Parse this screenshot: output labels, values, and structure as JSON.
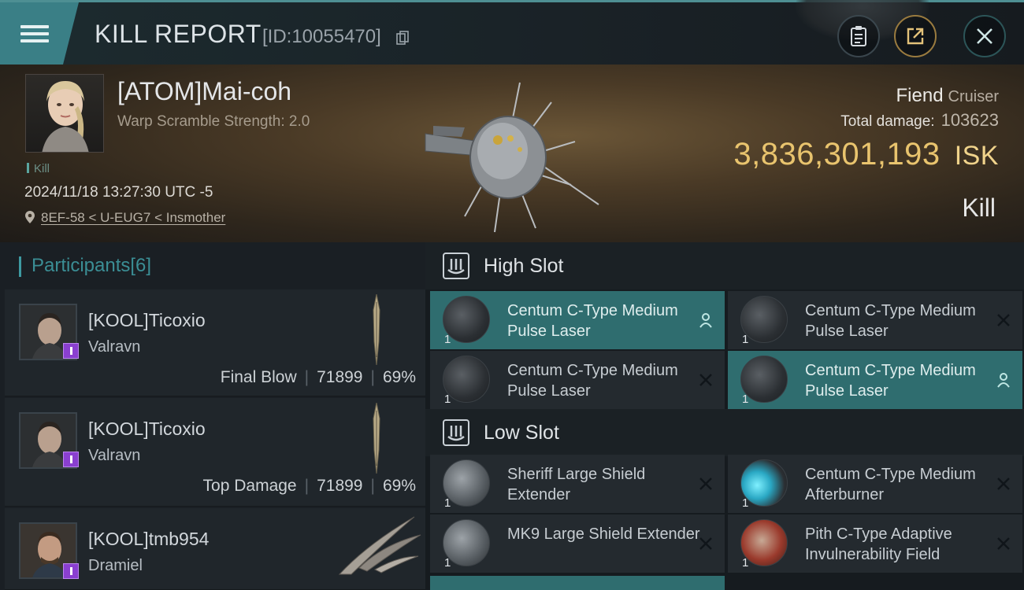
{
  "header": {
    "title": "KILL REPORT",
    "report_id": "[ID:10055470]",
    "icons": [
      "menu-icon",
      "copy-icon",
      "clipboard-icon",
      "share-icon",
      "close-icon"
    ]
  },
  "victim": {
    "name": "[ATOM]Mai-coh",
    "warp_scramble": "Warp Scramble Strength: 2.0",
    "tag": "Kill",
    "datetime": "2024/11/18 13:27:30 UTC -5",
    "location": "8EF-58 < U-EUG7 < Insmother",
    "ship_name": "Fiend",
    "ship_class": "Cruiser",
    "total_damage_label": "Total damage:",
    "total_damage": "103623",
    "isk_value": "3,836,301,193",
    "isk_unit": "ISK",
    "result": "Kill"
  },
  "participants": {
    "label": "Participants",
    "count": "[6]",
    "rows": [
      {
        "name": "[KOOL]Ticoxio",
        "ship": "Valravn",
        "role": "Final Blow",
        "damage": "71899",
        "percent": "69%"
      },
      {
        "name": "[KOOL]Ticoxio",
        "ship": "Valravn",
        "role": "Top Damage",
        "damage": "71899",
        "percent": "69%"
      },
      {
        "name": "[KOOL]tmb954",
        "ship": "Dramiel",
        "role": "",
        "damage": "",
        "percent": ""
      }
    ]
  },
  "slots": {
    "high": {
      "label": "High Slot",
      "modules": [
        {
          "name": "Centum C-Type Medium Pulse Laser",
          "qty": "1",
          "state": "dropped",
          "highlight": true
        },
        {
          "name": "Centum C-Type Medium Pulse Laser",
          "qty": "1",
          "state": "destroyed",
          "highlight": false
        },
        {
          "name": "Centum C-Type Medium Pulse Laser",
          "qty": "1",
          "state": "destroyed",
          "highlight": false
        },
        {
          "name": "Centum C-Type Medium Pulse Laser",
          "qty": "1",
          "state": "dropped",
          "highlight": true
        }
      ]
    },
    "low": {
      "label": "Low Slot",
      "modules": [
        {
          "name": "Sheriff Large Shield Extender",
          "qty": "1",
          "state": "destroyed",
          "highlight": false
        },
        {
          "name": "Centum C-Type Medium Afterburner",
          "qty": "1",
          "state": "destroyed",
          "highlight": false
        },
        {
          "name": "MK9 Large Shield Extender",
          "qty": "1",
          "state": "destroyed",
          "highlight": false
        },
        {
          "name": "Pith C-Type Adaptive Invulnerability Field",
          "qty": "1",
          "state": "destroyed",
          "highlight": false
        }
      ]
    }
  },
  "colors": {
    "accent_teal": "#3a7f86",
    "isk_gold": "#e9c46e",
    "highlight_row": "#2f6d6f",
    "badge_purple": "#8a3fd0"
  }
}
